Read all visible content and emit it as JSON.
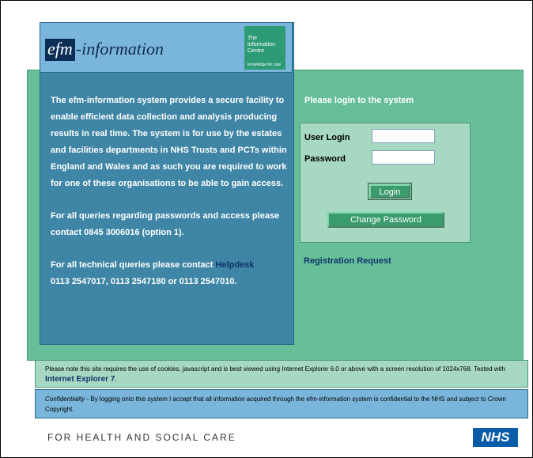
{
  "header": {
    "logo_efm": "efm",
    "logo_information": "-information",
    "ic_logo_line1": "The",
    "ic_logo_line2": "Information",
    "ic_logo_line3": "Centre",
    "ic_logo_tag": "knowledge for care"
  },
  "info": {
    "paragraph1": "The efm-information system provides a secure facility to enable efficient data collection and analysis producing results in real time. The system is for use by the estates and facilities departments in NHS Trusts and PCTs within England and Wales and as such you are required to work for one of these organisations to be able to gain access.",
    "paragraph2": "For all queries regarding passwords and access please contact 0845 3006016 (option 1).",
    "paragraph3_prefix": "For all technical queries please contact",
    "helpdesk_link": "Helpdesk",
    "paragraph3_phones": "0113 2547017, 0113 2547180 or 0113 2547010."
  },
  "login": {
    "heading": "Please login to the system",
    "user_label": "User Login",
    "user_value": "",
    "password_label": "Password",
    "password_value": "",
    "login_button": "Login",
    "change_password_button": "Change Password",
    "registration_link": "Registration Request"
  },
  "notes": {
    "browser_note_prefix": "Please note this site requires the use of cookies, javascript and is best viewed using Internet Explorer 6.0 or above with a screen resolution of 1024x768. Tested with",
    "browser_note_ie7": "Internet Explorer 7",
    "browser_note_suffix": ".",
    "confidentiality_label": "Confidentiality",
    "confidentiality_text": " - By logging onto this system I accept that all information acquired through the efm-information system is confidential to the NHS and subject to Crown Copyright."
  },
  "footer": {
    "tagline": "FOR HEALTH AND SOCIAL CARE",
    "nhs_logo": "NHS"
  },
  "colors": {
    "green_panel": "#66bf99",
    "blue_panel": "#3f86a6",
    "light_blue": "#7ab6dc",
    "light_green": "#a6d8c2",
    "nhs_blue": "#0a5ba8"
  }
}
